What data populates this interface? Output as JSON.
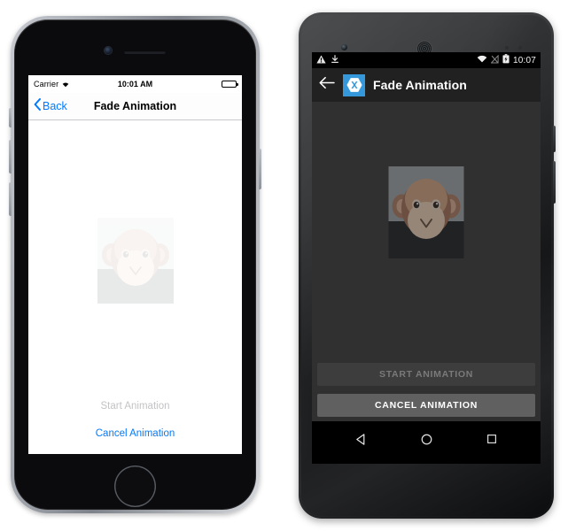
{
  "meta": {
    "scene": "Side-by-side iOS and Android screenshots of a Fade Animation sample app",
    "accent_ios": "#007aff",
    "accent_android": "#3498db",
    "android_appbar_bg": "#212121",
    "android_content_bg": "#303030",
    "android_button_disabled_bg": "#3d3d3d",
    "android_button_enabled_bg": "#606060"
  },
  "ios": {
    "device_name": "iphone",
    "status_bar": {
      "carrier": "Carrier",
      "wifi_icon": "wifi-icon",
      "time": "10:01 AM",
      "battery_icon": "battery-icon"
    },
    "nav_bar": {
      "back_icon": "chevron-left-icon",
      "back_label": "Back",
      "title": "Fade Animation"
    },
    "content": {
      "image_name": "monkey-image",
      "image_opacity": "0.10"
    },
    "buttons": {
      "start_label": "Start Animation",
      "start_enabled": false,
      "cancel_label": "Cancel Animation",
      "cancel_enabled": true
    },
    "hardware": {
      "camera": "front-camera",
      "speaker": "earpiece-speaker",
      "home_button": "home-button"
    }
  },
  "android": {
    "device_name": "android-phone",
    "status_bar": {
      "warning_icon": "warning-triangle-icon",
      "download_icon": "download-icon",
      "wifi_icon": "wifi-icon",
      "signal_icon": "no-signal-icon",
      "battery_icon": "battery-charging-icon",
      "time": "10:07"
    },
    "app_bar": {
      "back_icon": "arrow-left-icon",
      "logo_icon": "xamarin-logo-icon",
      "title": "Fade Animation"
    },
    "content": {
      "image_name": "monkey-image",
      "image_opacity": "0.55"
    },
    "buttons": {
      "start_label": "START ANIMATION",
      "start_enabled": false,
      "cancel_label": "CANCEL ANIMATION",
      "cancel_enabled": true
    },
    "nav_bar": {
      "back_icon": "triangle-back-icon",
      "home_icon": "circle-home-icon",
      "recents_icon": "square-recents-icon"
    },
    "hardware": {
      "camera": "front-camera",
      "speaker": "earpiece-speaker",
      "sensors": "proximity-sensors"
    }
  }
}
